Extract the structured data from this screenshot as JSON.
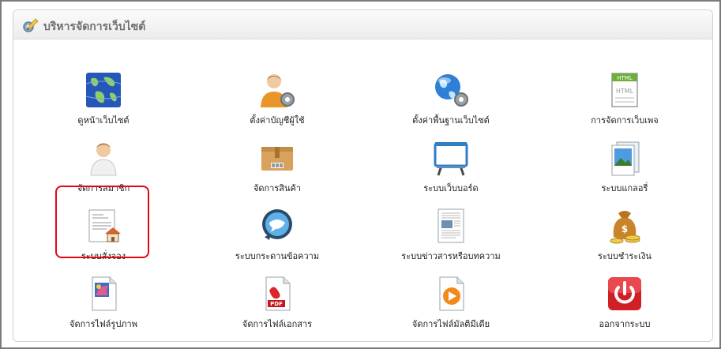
{
  "panel": {
    "title": "บริหารจัดการเว็บไซต์",
    "title_icon": "pencil-gear-icon"
  },
  "highlight_color": "#e30613",
  "items": [
    {
      "label": "ดูหน้าเว็บไซต์",
      "icon": "globe-map-icon"
    },
    {
      "label": "ตั้งค่าบัญชีผู้ใช้",
      "icon": "user-gear-icon"
    },
    {
      "label": "ตั้งค่าพื้นฐานเว็บไซต์",
      "icon": "globe-gear-icon"
    },
    {
      "label": "การจัดการเว็บเพจ",
      "icon": "html-page-icon"
    },
    {
      "label": "จัดการสมาชิก",
      "icon": "member-icon"
    },
    {
      "label": "จัดการสินค้า",
      "icon": "product-box-icon"
    },
    {
      "label": "ระบบเว็บบอร์ด",
      "icon": "webboard-icon"
    },
    {
      "label": "ระบบแกลอรี่",
      "icon": "gallery-icon"
    },
    {
      "label": "ระบบสั่งจอง",
      "icon": "booking-invoice-icon"
    },
    {
      "label": "ระบบกระดานข้อความ",
      "icon": "chat-bubble-icon"
    },
    {
      "label": "ระบบข่าวสารหรือบทความ",
      "icon": "news-article-icon"
    },
    {
      "label": "ระบบชำระเงิน",
      "icon": "money-bag-icon"
    },
    {
      "label": "จัดการไฟล์รูปภาพ",
      "icon": "image-file-icon"
    },
    {
      "label": "จัดการไฟล์เอกสาร",
      "icon": "pdf-file-icon"
    },
    {
      "label": "จัดการไฟล์มัลติมีเดีย",
      "icon": "media-file-icon"
    },
    {
      "label": "ออกจากระบบ",
      "icon": "power-icon"
    }
  ]
}
